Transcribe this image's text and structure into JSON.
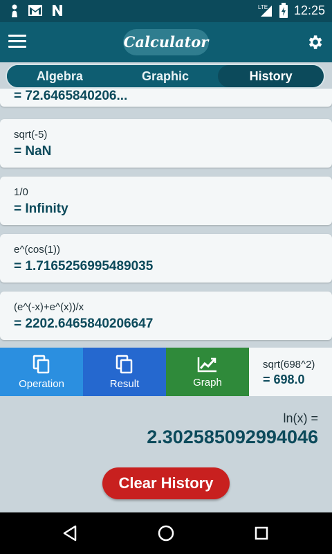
{
  "status_bar": {
    "time": "12:25",
    "network": "LTE"
  },
  "app_bar": {
    "title": "Calculator"
  },
  "tabs": [
    {
      "label": "Algebra"
    },
    {
      "label": "Graphic"
    },
    {
      "label": "History"
    }
  ],
  "history": [
    {
      "expression": "",
      "result": "= 72.6465840206... (partially visible)"
    },
    {
      "expression": "sqrt(-5)",
      "result": "= NaN"
    },
    {
      "expression": "1/0",
      "result": "= Infinity"
    },
    {
      "expression": "e^(cos(1))",
      "result": "= 1.7165256995489035"
    },
    {
      "expression": "(e^(-x)+e^(x))/x",
      "result": "= 2202.6465840206647"
    }
  ],
  "actions": {
    "operation_label": "Operation",
    "result_label": "Result",
    "graph_label": "Graph"
  },
  "last_item": {
    "expression": "sqrt(698^2)",
    "result": "= 698.0"
  },
  "display": {
    "expression": "ln(x) =",
    "value": "2.302585092994046"
  },
  "clear_button": {
    "label": "Clear History"
  },
  "colors": {
    "primary": "#0e5d71",
    "status": "#0c4a5b",
    "operation": "#2b8fe0",
    "result": "#2568cf",
    "graph": "#2f8a3a",
    "clear": "#c8201f"
  }
}
